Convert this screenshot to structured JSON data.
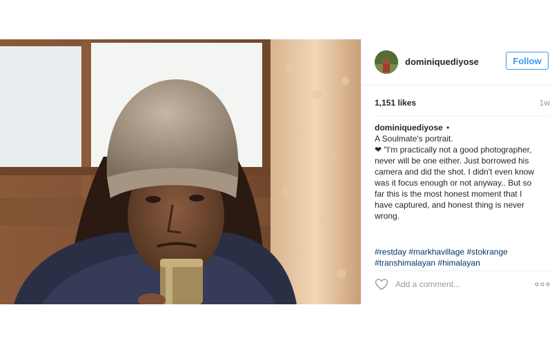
{
  "post": {
    "username": "dominiquediyose",
    "follow_label": "Follow",
    "likes": "1,151 likes",
    "time": "1w",
    "caption": {
      "username": "dominiquediyose",
      "dot": "•",
      "line1": "A Soulmate's portrait.",
      "body": "\"I'm practically not a good photographer, never will be one either. Just borrowed his camera and did the shot. I didn't even know was it focus enough or not anyway.. But so far this is the most honest moment that I have captured, and honest thing is never wrong.",
      "faded": "."
    },
    "hashtags": [
      "#restday",
      "#markhavillage",
      "#stokrange",
      "#transhimalayan",
      "#himalayan"
    ],
    "comment_placeholder": "Add a comment...",
    "icons": {
      "heart": "heart-outline-icon",
      "more": "more-options-icon",
      "caption_heart": "black-heart-icon"
    },
    "colors": {
      "accent": "#3897f0",
      "hashtag": "#003569",
      "muted": "#999999"
    }
  }
}
